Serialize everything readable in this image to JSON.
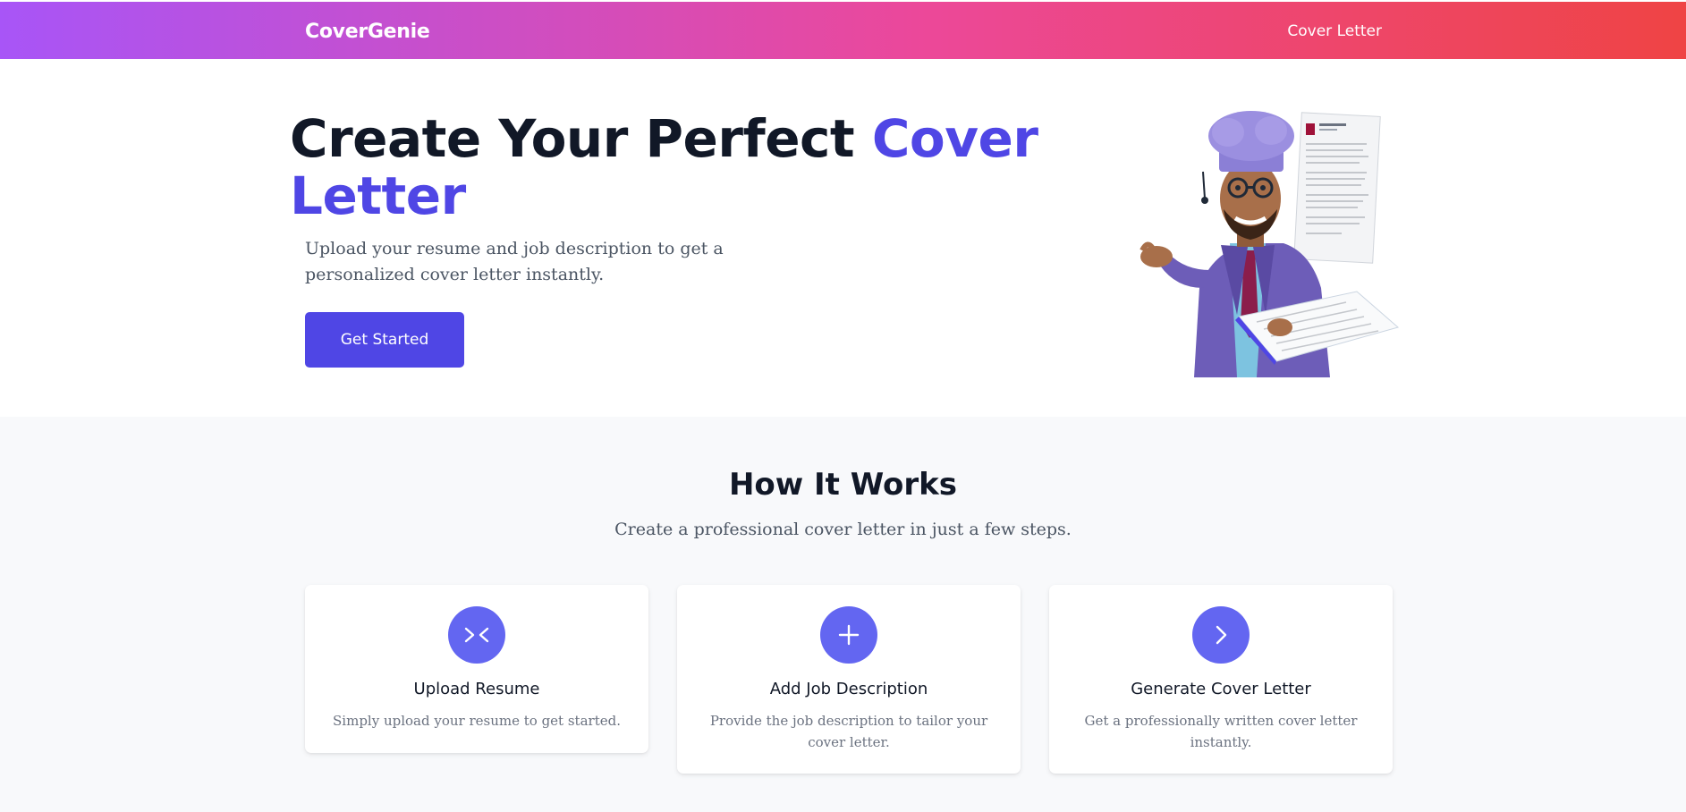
{
  "header": {
    "brand": "CoverGenie",
    "nav_link": "Cover Letter"
  },
  "hero": {
    "title_part1": "Create Your Perfect ",
    "title_accent": "Cover Letter",
    "subtitle": "Upload your resume and job description to get a personalized cover letter instantly.",
    "cta_label": "Get Started"
  },
  "how_it_works": {
    "title": "How It Works",
    "subtitle": "Create a professional cover letter in just a few steps.",
    "steps": [
      {
        "icon": "collapse-arrows-icon",
        "title": "Upload Resume",
        "description": "Simply upload your resume to get started."
      },
      {
        "icon": "plus-icon",
        "title": "Add Job Description",
        "description": "Provide the job description to tailor your cover letter."
      },
      {
        "icon": "chevron-right-icon",
        "title": "Generate Cover Letter",
        "description": "Get a professionally written cover letter instantly."
      }
    ]
  },
  "colors": {
    "header_gradient": [
      "#a855f7",
      "#ec4899",
      "#ef4444"
    ],
    "accent": "#4f46e5",
    "icon_circle": "#6366f1",
    "section_bg": "#f8f9fb"
  }
}
